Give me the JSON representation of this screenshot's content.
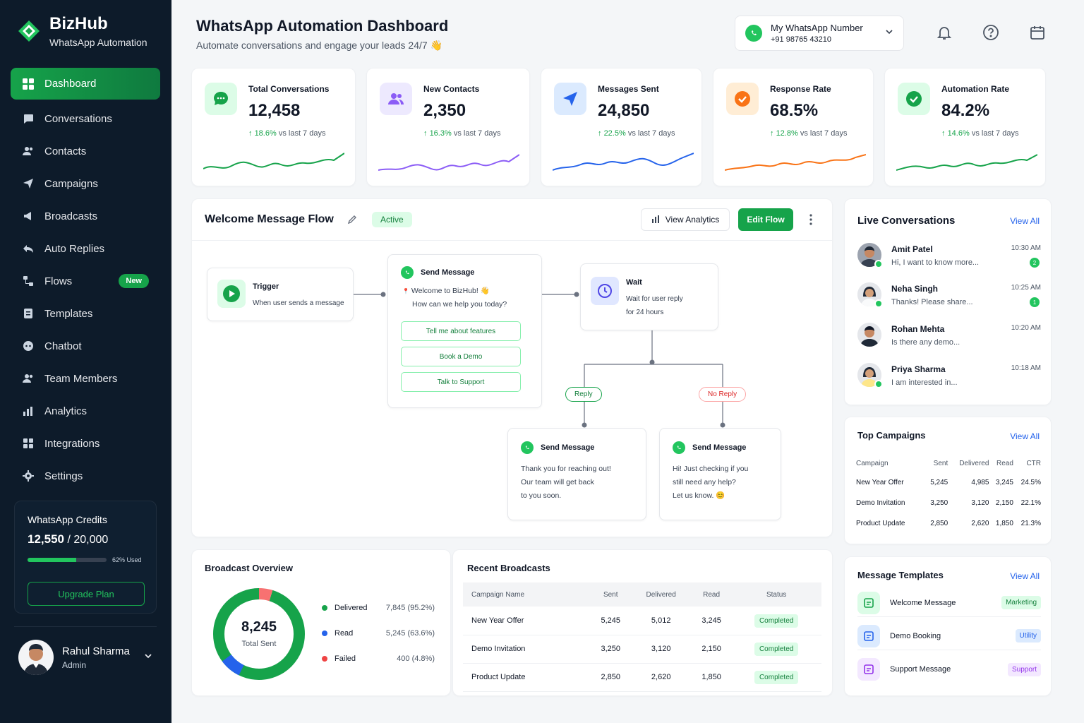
{
  "brand": {
    "name": "BizHub",
    "subtitle": "WhatsApp Automation"
  },
  "nav": [
    {
      "label": "Dashboard",
      "icon": "grid-icon"
    },
    {
      "label": "Conversations",
      "icon": "chat-icon"
    },
    {
      "label": "Contacts",
      "icon": "users-icon"
    },
    {
      "label": "Campaigns",
      "icon": "send-icon"
    },
    {
      "label": "Broadcasts",
      "icon": "megaphone-icon"
    },
    {
      "label": "Auto Replies",
      "icon": "reply-icon"
    },
    {
      "label": "Flows",
      "icon": "flow-icon",
      "badge": "New"
    },
    {
      "label": "Templates",
      "icon": "template-icon"
    },
    {
      "label": "Chatbot",
      "icon": "bot-icon"
    },
    {
      "label": "Team Members",
      "icon": "team-icon"
    },
    {
      "label": "Analytics",
      "icon": "bar-chart-icon"
    },
    {
      "label": "Integrations",
      "icon": "puzzle-icon"
    },
    {
      "label": "Settings",
      "icon": "gear-icon"
    }
  ],
  "credits": {
    "title": "WhatsApp Credits",
    "used": "12,550",
    "total": " / 20,000",
    "percent_label": "62% Used",
    "fraction": 0.62,
    "button": "Upgrade Plan"
  },
  "profile": {
    "name": "Rahul Sharma",
    "role": "Admin"
  },
  "header": {
    "title": "WhatsApp Automation Dashboard",
    "subtitle": "Automate conversations and engage your leads 24/7 👋",
    "number_label": "My WhatsApp Number",
    "number_value": "+91 98765 43210"
  },
  "stats": [
    {
      "label": "Total Conversations",
      "value": "12,458",
      "change": "18.6%",
      "period": " vs last 7 days",
      "color": "#16a34a",
      "icon_bg": "#dcfce7",
      "icon": "chat-bubble-icon"
    },
    {
      "label": "New Contacts",
      "value": "2,350",
      "change": "16.3%",
      "period": " vs last 7 days",
      "color": "#8b5cf6",
      "icon_bg": "#ede9fe",
      "icon": "users-icon"
    },
    {
      "label": "Messages Sent",
      "value": "24,850",
      "change": "22.5%",
      "period": " vs last 7 days",
      "color": "#2563eb",
      "icon_bg": "#dbeafe",
      "icon": "paper-plane-icon"
    },
    {
      "label": "Response Rate",
      "value": "68.5%",
      "change": "12.8%",
      "period": " vs last 7 days",
      "color": "#f97316",
      "icon_bg": "#ffedd5",
      "icon": "check-circle-icon"
    },
    {
      "label": "Automation Rate",
      "value": "84.2%",
      "change": "14.6%",
      "period": " vs last 7 days",
      "color": "#16a34a",
      "icon_bg": "#dcfce7",
      "icon": "check-circle-icon"
    }
  ],
  "flow": {
    "title": "Welcome Message Flow",
    "status": "Active",
    "analytics_btn": "View Analytics",
    "edit_btn": "Edit Flow",
    "trigger": {
      "title": "Trigger",
      "text": "When user sends a message"
    },
    "send": {
      "title": "Send Message",
      "line1": "Welcome to BizHub! 👋",
      "line2": "How can we help you today?",
      "options": [
        "Tell me about features",
        "Book a Demo",
        "Talk to Support"
      ]
    },
    "wait": {
      "title": "Wait",
      "line1": "Wait for user reply",
      "line2": "for 24 hours"
    },
    "reply_label": "Reply",
    "noreply_label": "No Reply",
    "reply_node": {
      "title": "Send Message",
      "lines": [
        "Thank you for reaching out!",
        "Our team will get back",
        "to you soon."
      ]
    },
    "noreply_node": {
      "title": "Send Message",
      "lines": [
        "Hi! Just checking if you",
        "still need any help?",
        "Let us know. 😊"
      ]
    }
  },
  "live": {
    "title": "Live Conversations",
    "view_all": "View All",
    "items": [
      {
        "name": "Amit Patel",
        "msg": "Hi, I want to know more...",
        "time": "10:30 AM",
        "count": "2"
      },
      {
        "name": "Neha Singh",
        "msg": "Thanks! Please share...",
        "time": "10:25 AM",
        "count": "1"
      },
      {
        "name": "Rohan Mehta",
        "msg": "Is there any demo...",
        "time": "10:20 AM",
        "count": ""
      },
      {
        "name": "Priya Sharma",
        "msg": "I am interested in...",
        "time": "10:18 AM",
        "count": ""
      }
    ]
  },
  "top_campaigns": {
    "title": "Top Campaigns",
    "view_all": "View All",
    "headers": [
      "Campaign",
      "Sent",
      "Delivered",
      "Read",
      "CTR"
    ],
    "rows": [
      [
        "New Year Offer",
        "5,245",
        "4,985",
        "3,245",
        "24.5%"
      ],
      [
        "Demo Invitation",
        "3,250",
        "3,120",
        "2,150",
        "22.1%"
      ],
      [
        "Product Update",
        "2,850",
        "2,620",
        "1,850",
        "21.3%"
      ]
    ]
  },
  "templates": {
    "title": "Message Templates",
    "view_all": "View All",
    "items": [
      {
        "name": "Welcome Message",
        "tag": "Marketing",
        "color": "#16a34a",
        "bg": "#dcfce7"
      },
      {
        "name": "Demo Booking",
        "tag": "Utility",
        "color": "#2563eb",
        "bg": "#dbeafe"
      },
      {
        "name": "Support Message",
        "tag": "Support",
        "color": "#9333ea",
        "bg": "#f3e8ff"
      }
    ]
  },
  "broadcast": {
    "title": "Broadcast Overview",
    "total": "8,245",
    "total_label": "Total Sent",
    "legend": [
      {
        "label": "Delivered",
        "value": "7,845 (95.2%)",
        "color": "#16a34a"
      },
      {
        "label": "Read",
        "value": "5,245 (63.6%)",
        "color": "#2563eb"
      },
      {
        "label": "Failed",
        "value": "400 (4.8%)",
        "color": "#ef4444"
      }
    ]
  },
  "recent": {
    "title": "Recent Broadcasts",
    "headers": [
      "Campaign Name",
      "Sent",
      "Delivered",
      "Read",
      "Status"
    ],
    "rows": [
      [
        "New Year Offer",
        "5,245",
        "5,012",
        "3,245",
        "Completed"
      ],
      [
        "Demo Invitation",
        "3,250",
        "3,120",
        "2,150",
        "Completed"
      ],
      [
        "Product Update",
        "2,850",
        "2,620",
        "1,850",
        "Completed"
      ]
    ]
  }
}
